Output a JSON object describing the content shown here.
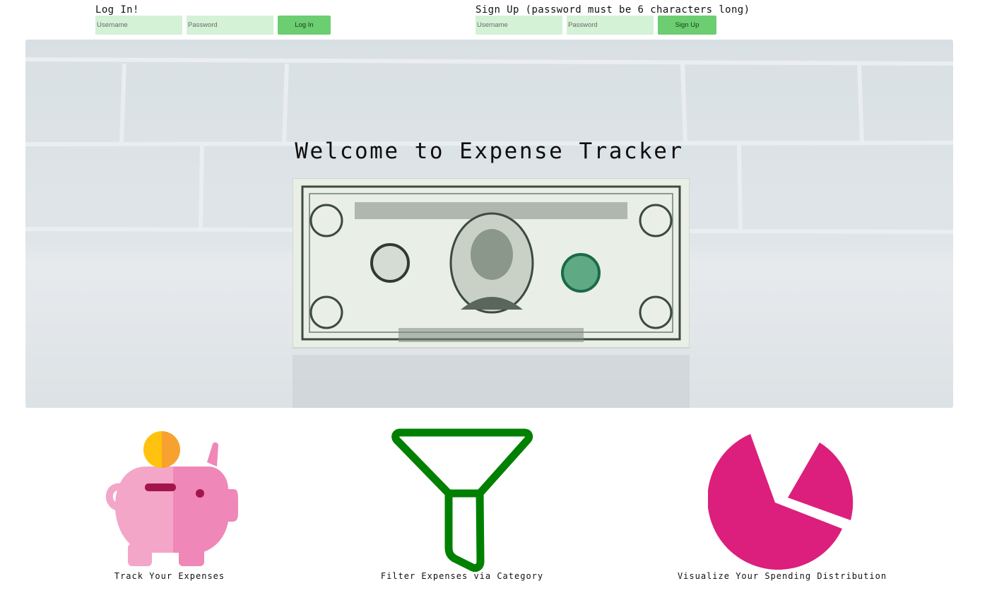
{
  "login": {
    "title": "Log In!",
    "username_placeholder": "Username",
    "password_placeholder": "Password",
    "button_label": "Log In"
  },
  "signup": {
    "title": "Sign Up (password must be 6 characters long)",
    "username_placeholder": "Username",
    "password_placeholder": "Password",
    "button_label": "Sign Up"
  },
  "hero": {
    "title": "Welcome to Expense Tracker",
    "image": "dollar-bill-photo"
  },
  "features": [
    {
      "icon": "piggy-bank-icon",
      "caption": "Track Your Expenses"
    },
    {
      "icon": "funnel-icon",
      "caption": "Filter Expenses via Category"
    },
    {
      "icon": "pie-chart-icon",
      "caption": "Visualize Your Spending Distribution"
    }
  ],
  "colors": {
    "input_bg": "#d4f2d6",
    "button_bg": "#6ccd71",
    "piggy_pink": "#f4a6c8",
    "piggy_pink_dark": "#ef87b8",
    "coin_yellow": "#ffc20e",
    "coin_orange": "#f7a12f",
    "funnel_green": "#008000",
    "pie_magenta": "#dc1f7c"
  }
}
